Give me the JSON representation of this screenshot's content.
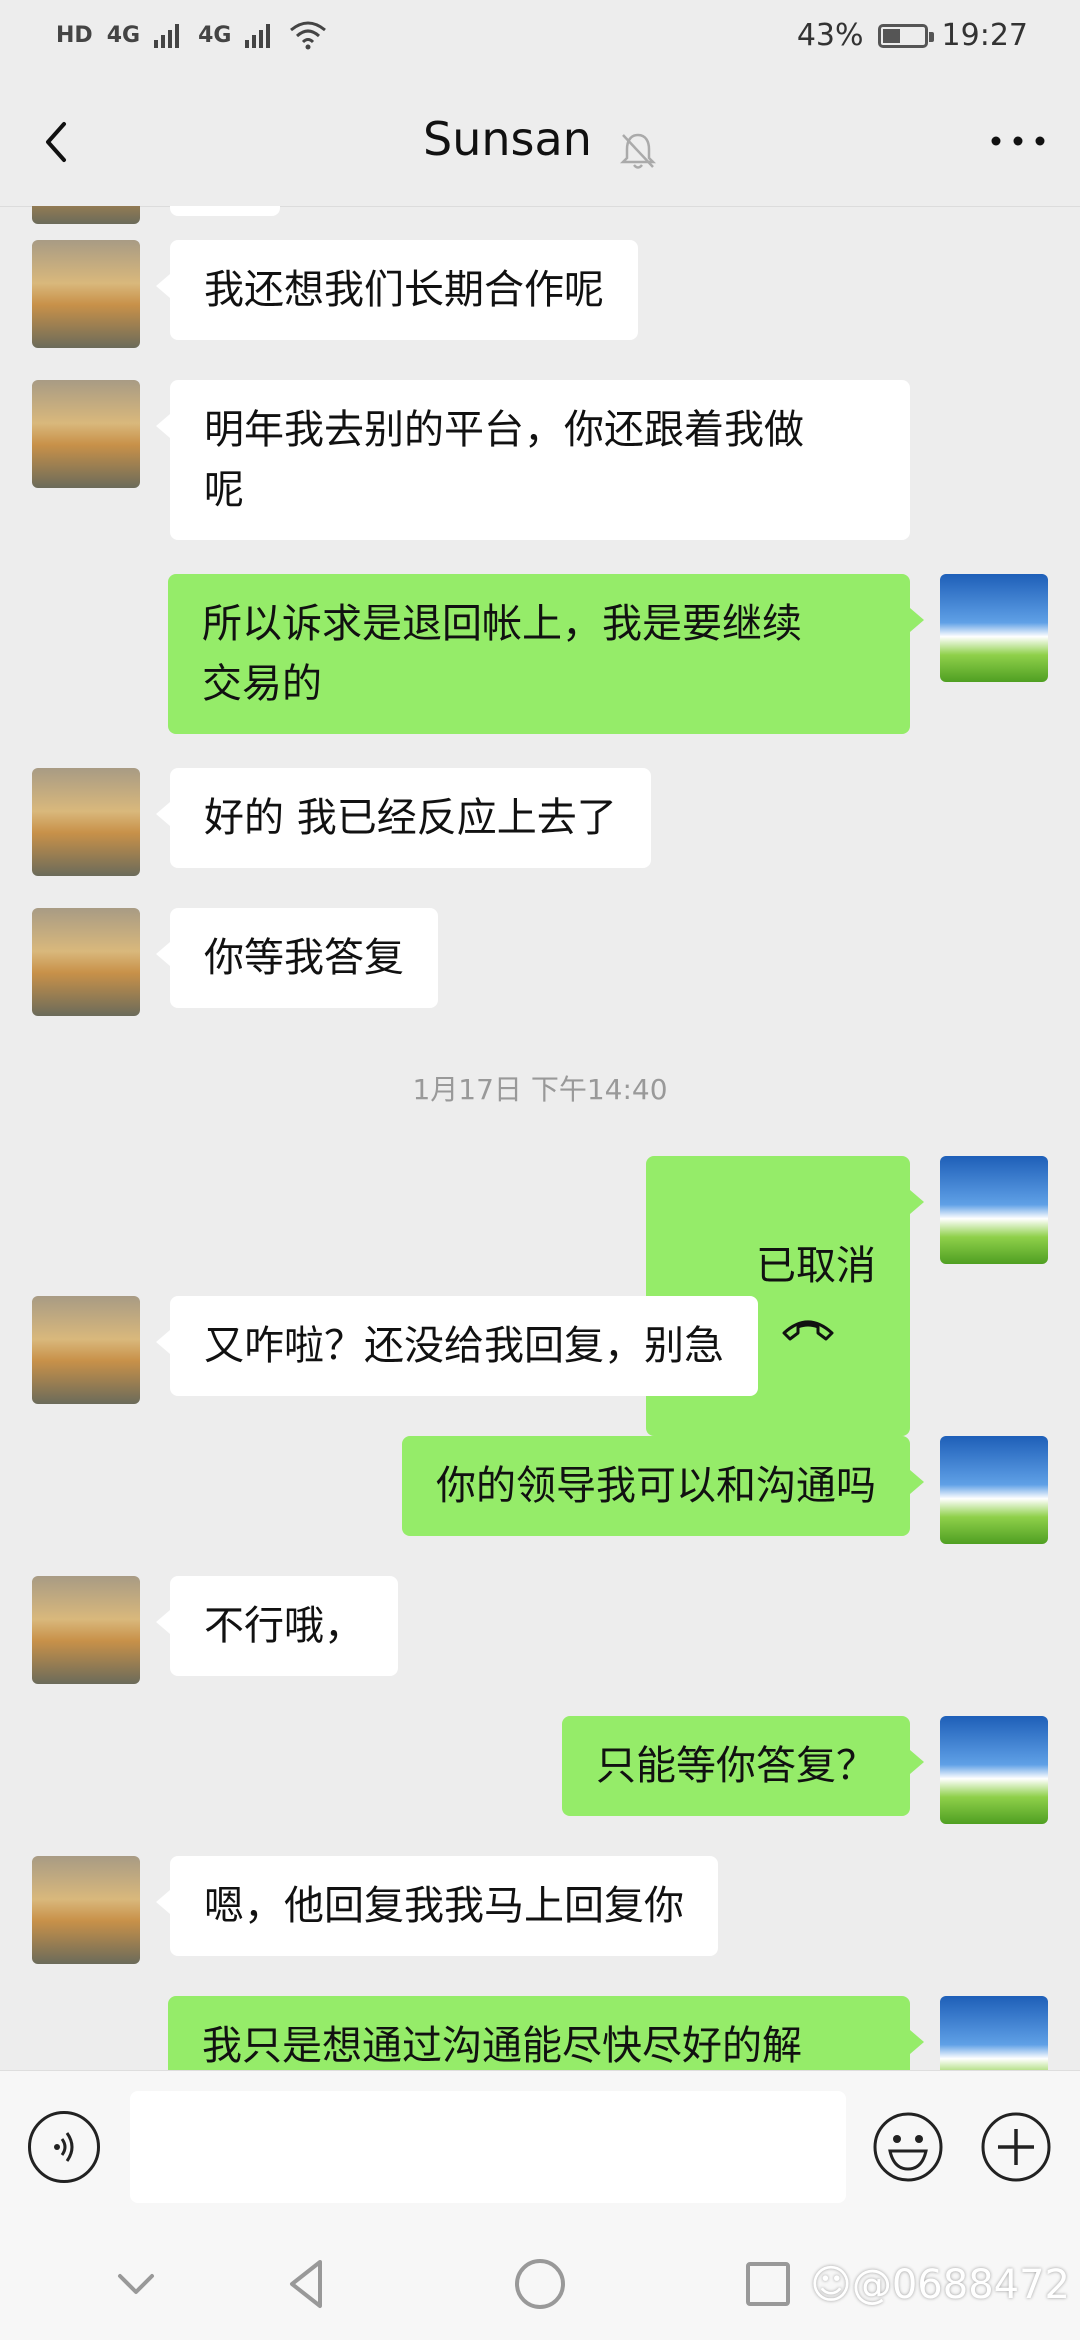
{
  "status_bar": {
    "left_items": [
      "HD",
      "4G",
      "4G"
    ],
    "battery_percent": "43%",
    "battery_level": 0.43,
    "time": "19:27"
  },
  "header": {
    "title": "Sunsan",
    "icons": [
      "back-icon",
      "mute-bell-icon",
      "more-icon"
    ]
  },
  "messages": [
    {
      "side": "in",
      "text": "我还想我们长期合作呢"
    },
    {
      "side": "in",
      "text": "明年我去别的平台，你还跟着我做\n呢"
    },
    {
      "side": "out",
      "text": "所以诉求是退回帐上，我是要继续\n交易的"
    },
    {
      "side": "in",
      "text": "好的 我已经反应上去了"
    },
    {
      "side": "in",
      "text": "你等我答复"
    },
    {
      "side": "time",
      "text": "1月17日 下午14:40"
    },
    {
      "side": "out",
      "text": "已取消",
      "icon": "call-hangup-icon"
    },
    {
      "side": "in",
      "text": "又咋啦？还没给我回复，别急"
    },
    {
      "side": "out",
      "text": "你的领导我可以和沟通吗"
    },
    {
      "side": "in",
      "text": "不行哦，"
    },
    {
      "side": "out",
      "text": "只能等你答复？"
    },
    {
      "side": "in",
      "text": "嗯，他回复我我马上回复你"
    },
    {
      "side": "out",
      "text": "我只是想通过沟通能尽快尽好的解"
    }
  ],
  "input_bar": {
    "value": "",
    "icons": [
      "voice-icon",
      "emoji-icon",
      "plus-icon"
    ]
  },
  "nav_bar": {
    "icons": [
      "collapse-icon",
      "back-triangle-icon",
      "home-circle-icon",
      "recents-square-icon"
    ]
  },
  "watermark": "@0688472"
}
